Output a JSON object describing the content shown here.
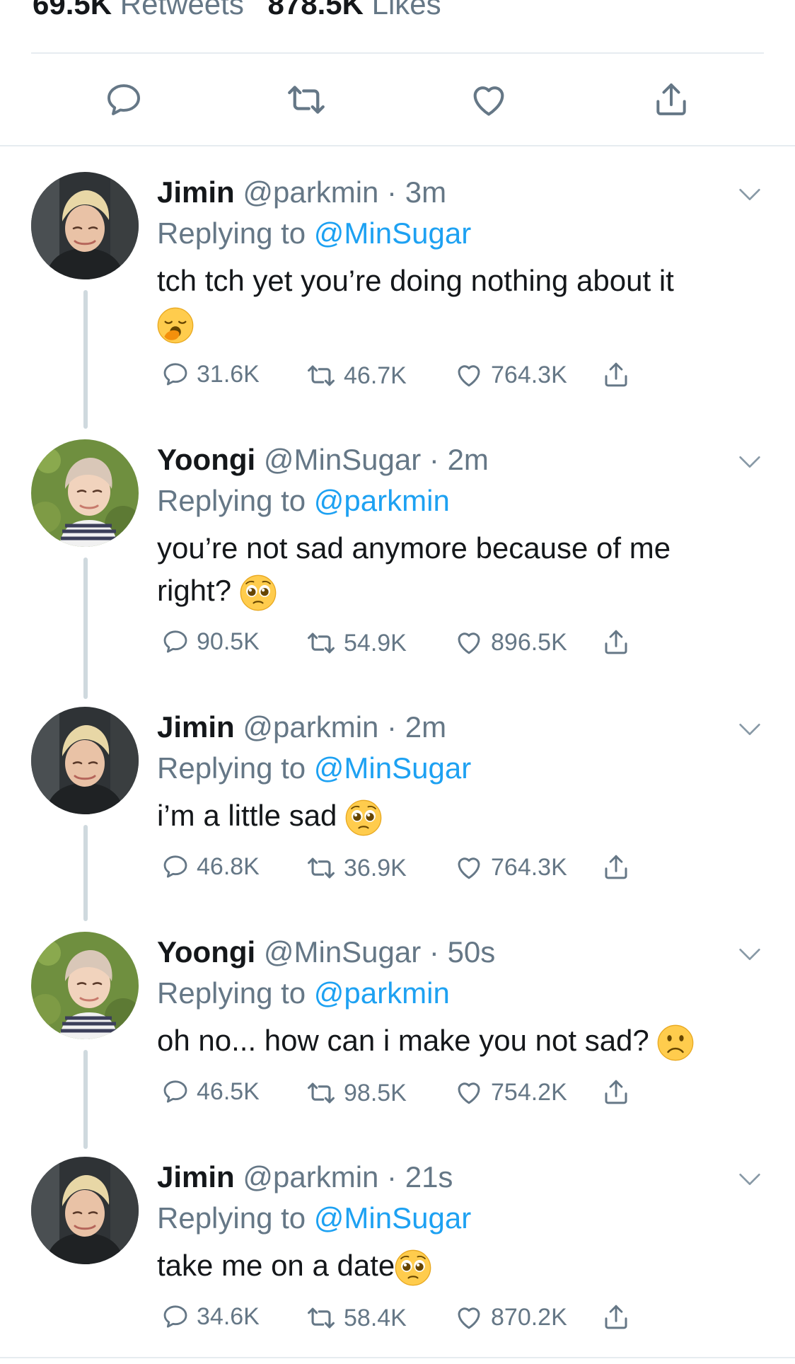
{
  "top_stats": {
    "retweets_count": "69.5K",
    "retweets_label": "Retweets",
    "likes_count": "878.5K",
    "likes_label": "Likes"
  },
  "main_actions": [
    "reply-icon",
    "retweet-icon",
    "like-icon",
    "share-icon"
  ],
  "colors": {
    "link": "#1da1f2",
    "secondary": "#657786",
    "divider": "#e6ecf0"
  },
  "tweets": [
    {
      "name": "Jimin",
      "handle": "@parkmin",
      "time": "3m",
      "replying_prefix": "Replying to",
      "replying_to": "@MinSugar",
      "text": "tch tch yet you’re doing nothing about it",
      "emoji": "yawning-face",
      "replies": "31.6K",
      "retweets": "46.7K",
      "likes": "764.3K"
    },
    {
      "name": "Yoongi",
      "handle": "@MinSugar",
      "time": "2m",
      "replying_prefix": "Replying to",
      "replying_to": "@parkmin",
      "text": "you’re not sad anymore because of me right?",
      "emoji": "pleading-face",
      "replies": "90.5K",
      "retweets": "54.9K",
      "likes": "896.5K"
    },
    {
      "name": "Jimin",
      "handle": "@parkmin",
      "time": "2m",
      "replying_prefix": "Replying to",
      "replying_to": "@MinSugar",
      "text": "i’m a little sad",
      "emoji": "pleading-face",
      "replies": "46.8K",
      "retweets": "36.9K",
      "likes": "764.3K"
    },
    {
      "name": "Yoongi",
      "handle": "@MinSugar",
      "time": "50s",
      "replying_prefix": "Replying to",
      "replying_to": "@parkmin",
      "text": "oh no... how can i make you not sad?",
      "emoji": "frowning-face",
      "replies": "46.5K",
      "retweets": "98.5K",
      "likes": "754.2K"
    },
    {
      "name": "Jimin",
      "handle": "@parkmin",
      "time": "21s",
      "replying_prefix": "Replying to",
      "replying_to": "@MinSugar",
      "text": "take me on a date",
      "emoji": "pleading-face",
      "replies": "34.6K",
      "retweets": "58.4K",
      "likes": "870.2K"
    }
  ]
}
